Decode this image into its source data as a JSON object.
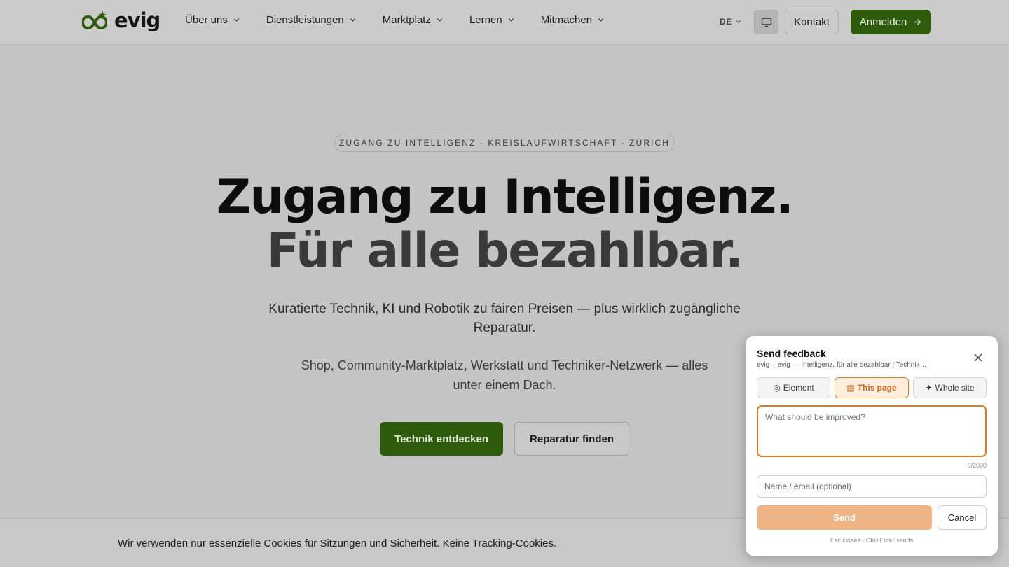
{
  "header": {
    "logo_text": "evig",
    "nav": [
      {
        "label": "Über uns"
      },
      {
        "label": "Dienstleistungen"
      },
      {
        "label": "Marktplatz"
      },
      {
        "label": "Lernen"
      },
      {
        "label": "Mitmachen"
      }
    ],
    "language": "DE",
    "kontakt_label": "Kontakt",
    "anmelden_label": "Anmelden",
    "icons": {
      "screen": "monitor-icon",
      "arrow": "arrow-right-icon"
    }
  },
  "hero": {
    "eyebrow": "ZUGANG ZU INTELLIGENZ · KREISLAUFWIRTSCHAFT · ZÜRICH",
    "headline_line1": "Zugang zu Intelligenz.",
    "headline_line2": "Für alle bezahlbar.",
    "lead": "Kuratierte Technik, KI und Robotik zu fairen Preisen — plus wirklich zugängliche Reparatur.",
    "sub": "Shop, Community-Marktplatz, Werkstatt und Techniker-Netzwerk — alles unter einem Dach.",
    "cta_primary": "Technik entdecken",
    "cta_secondary": "Reparatur finden"
  },
  "cookie": {
    "text": "Wir verwenden nur essenzielle Cookies für Sitzungen und Sicherheit. Keine Tracking-Cookies."
  },
  "feedback": {
    "title": "Send feedback",
    "subtitle": "evig – evig — Intelligenz, für alle bezahlbar | Technik…",
    "scopes": [
      {
        "icon": "◎",
        "label": "Element"
      },
      {
        "icon": "▤",
        "label": "This page"
      },
      {
        "icon": "✦",
        "label": "Whole site"
      }
    ],
    "selected_scope": "This page",
    "message_placeholder": "What should be improved?",
    "message_value": "",
    "char_count": "0/2000",
    "contact_placeholder": "Name / email (optional)",
    "send_label": "Send",
    "cancel_label": "Cancel",
    "hint": "Esc closes · Ctrl+Enter sends"
  },
  "colors": {
    "brand_green": "#2f5c0c",
    "accent_orange": "#e07a1e"
  }
}
